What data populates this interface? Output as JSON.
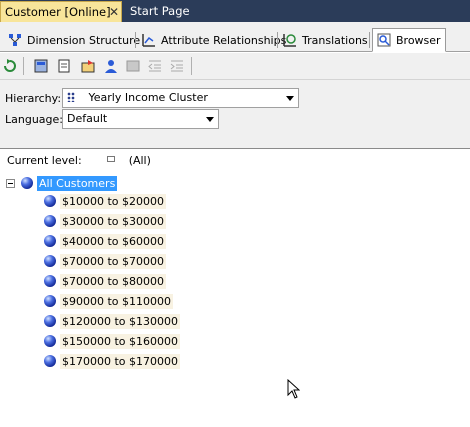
{
  "document_tabs": [
    {
      "label": "Customer [Online]",
      "active": true,
      "close_glyph": "✕"
    },
    {
      "label": "Start Page",
      "active": false
    }
  ],
  "designer_tabs": [
    {
      "label": "Dimension Structure",
      "icon": "dimension-structure-icon"
    },
    {
      "label": "Attribute Relationships",
      "icon": "attribute-relationships-icon"
    },
    {
      "label": "Translations",
      "icon": "translations-icon"
    },
    {
      "label": "Browser",
      "icon": "browser-icon",
      "selected": true
    }
  ],
  "toolbar": {
    "buttons": [
      "process-icon",
      "reconnect-icon",
      "member-properties-icon",
      "filter-icon",
      "user-icon",
      "disabled-icon",
      "decrease-indent-icon",
      "increase-indent-icon"
    ]
  },
  "properties": {
    "hierarchy_label": "Hierarchy:",
    "hierarchy_value": "Yearly Income Cluster",
    "language_label": "Language:",
    "language_value": "Default"
  },
  "browser": {
    "current_level_label": "Current level:",
    "current_level_value": "(All)",
    "root": "All Customers",
    "members": [
      "$10000 to $20000",
      "$30000 to $30000",
      "$40000 to $60000",
      "$70000 to $70000",
      "$70000 to $80000",
      "$90000 to $110000",
      "$120000 to $130000",
      "$150000 to $160000",
      "$170000 to $170000"
    ]
  },
  "colors": {
    "doc_tab_strip": "#2b3c59",
    "active_doc_tab": "#f8e59a",
    "selection": "#3399ff"
  }
}
